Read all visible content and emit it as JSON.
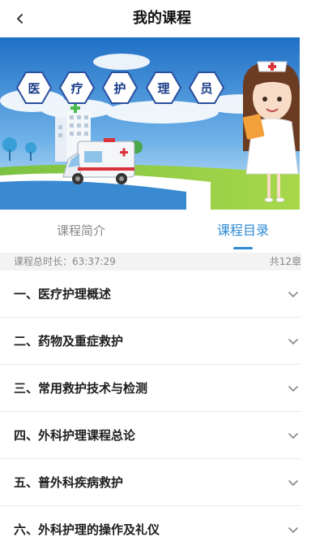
{
  "header": {
    "title": "我的课程",
    "back_icon": "chevron-left-icon"
  },
  "banner": {
    "badges": [
      "医",
      "疗",
      "护",
      "理",
      "员"
    ]
  },
  "tabs": [
    {
      "label": "课程简介",
      "active": false
    },
    {
      "label": "课程目录",
      "active": true
    }
  ],
  "summary": {
    "duration_text": "课程总时长：63:37:29",
    "count_text": "共12章"
  },
  "chapters": [
    {
      "title": "一、医疗护理概述"
    },
    {
      "title": "二、药物及重症救护"
    },
    {
      "title": "三、常用救护技术与检测"
    },
    {
      "title": "四、外科护理课程总论"
    },
    {
      "title": "五、普外科疾病救护"
    },
    {
      "title": "六、外科护理的操作及礼仪"
    }
  ],
  "colors": {
    "accent": "#2f8bd4",
    "text_primary": "#1e1e1e",
    "text_secondary": "#888888",
    "summary_bg": "#f3f3f3"
  }
}
